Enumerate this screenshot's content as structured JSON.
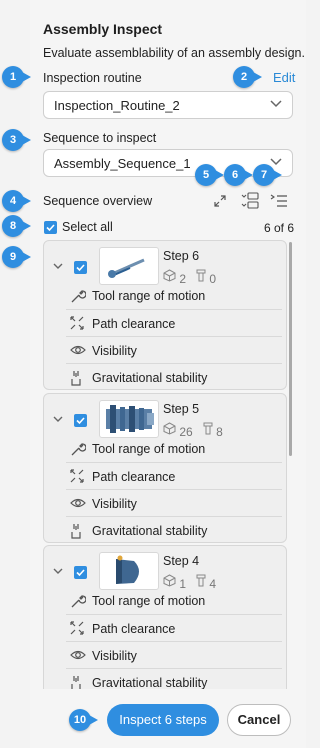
{
  "header": {
    "title": "Assembly Inspect",
    "description": "Evaluate assemblability of an assembly design."
  },
  "routine": {
    "label": "Inspection routine",
    "edit_label": "Edit",
    "value": "Inspection_Routine_2"
  },
  "sequence": {
    "label": "Sequence to inspect",
    "value": "Assembly_Sequence_1"
  },
  "overview": {
    "label": "Sequence overview",
    "select_all_label": "Select all",
    "count": "6 of 6"
  },
  "callouts": [
    "1",
    "2",
    "3",
    "4",
    "5",
    "6",
    "7",
    "8",
    "9",
    "10"
  ],
  "steps": [
    {
      "name": "Step 6",
      "parts": "2",
      "fasteners": "0",
      "checks": [
        "Tool range of motion",
        "Path clearance",
        "Visibility",
        "Gravitational stability"
      ]
    },
    {
      "name": "Step 5",
      "parts": "26",
      "fasteners": "8",
      "checks": [
        "Tool range of motion",
        "Path clearance",
        "Visibility",
        "Gravitational stability"
      ]
    },
    {
      "name": "Step 4",
      "parts": "1",
      "fasteners": "4",
      "checks": [
        "Tool range of motion",
        "Path clearance",
        "Visibility",
        "Gravitational stability"
      ]
    }
  ],
  "footer": {
    "inspect_label": "Inspect 6 steps",
    "cancel_label": "Cancel"
  },
  "icons": [
    "chevron-down-icon",
    "expand-icon",
    "collapse-all-icon",
    "list-indent-icon",
    "checkbox-icon",
    "cube-icon",
    "fastener-icon",
    "wrench-icon",
    "clearance-icon",
    "eye-icon",
    "gravity-icon"
  ],
  "colors": {
    "accent": "#2f8ee0",
    "panel": "#f5f5f5"
  }
}
